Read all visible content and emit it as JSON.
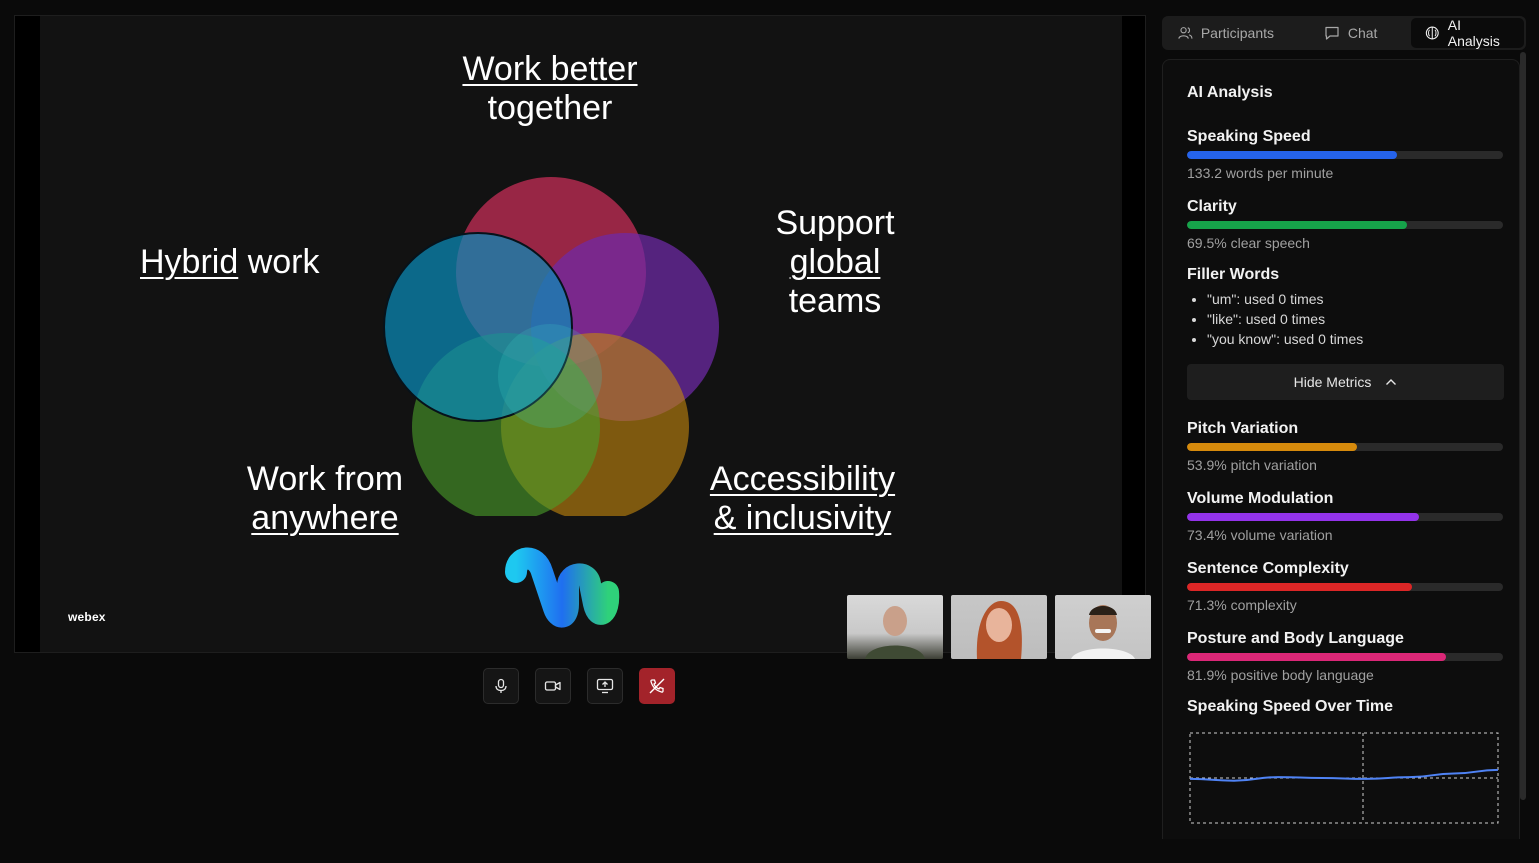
{
  "slide": {
    "top_line1": "Work better",
    "top_line2": "together",
    "hybrid_u": "Hybrid",
    "hybrid_rest": " work",
    "support_line1": "Support",
    "support_line2": "global",
    "support_line3": "teams",
    "anywhere_line1": "Work from",
    "anywhere_line2": "anywhere",
    "access_line1": "Accessibility",
    "access_line2": "& inclusivity",
    "brand": "webex"
  },
  "participants_thumbs": [
    {
      "name": "participant-1"
    },
    {
      "name": "participant-2"
    },
    {
      "name": "participant-3"
    }
  ],
  "controls": {
    "icons": [
      "microphone-icon",
      "camera-icon",
      "share-screen-icon",
      "end-call-icon"
    ],
    "end_color": "#a3232a"
  },
  "tabs": {
    "participants": "Participants",
    "chat": "Chat",
    "ai_analysis": "AI Analysis",
    "active": "ai_analysis"
  },
  "panel": {
    "title": "AI Analysis",
    "metrics": [
      {
        "label": "Speaking Speed",
        "fraction": 0.665,
        "text": "133.2 words per minute",
        "color": "#2563eb"
      },
      {
        "label": "Clarity",
        "fraction": 0.695,
        "text": "69.5% clear speech",
        "color": "#16a34a"
      }
    ],
    "filler": {
      "title": "Filler Words",
      "items": [
        "\"um\": used 0 times",
        "\"like\": used 0 times",
        "\"you know\": used 0 times"
      ]
    },
    "hide_button": "Hide Metrics",
    "more_metrics": [
      {
        "label": "Pitch Variation",
        "fraction": 0.539,
        "text": "53.9% pitch variation",
        "color": "#d68a0c"
      },
      {
        "label": "Volume Modulation",
        "fraction": 0.734,
        "text": "73.4% volume variation",
        "color": "#9333ea"
      },
      {
        "label": "Sentence Complexity",
        "fraction": 0.713,
        "text": "71.3% complexity",
        "color": "#dc2626"
      },
      {
        "label": "Posture and Body Language",
        "fraction": 0.819,
        "text": "81.9% positive body language",
        "color": "#db2777"
      }
    ],
    "chart_title": "Speaking Speed Over Time"
  },
  "chart_data": {
    "type": "line",
    "title": "Speaking Speed Over Time",
    "xlabel": "",
    "ylabel": "",
    "grid": true,
    "series": [
      {
        "values": [
          0.49,
          0.47,
          0.51,
          0.5,
          0.49,
          0.51,
          0.55,
          0.59
        ]
      }
    ],
    "line_color": "#4f83f5"
  }
}
